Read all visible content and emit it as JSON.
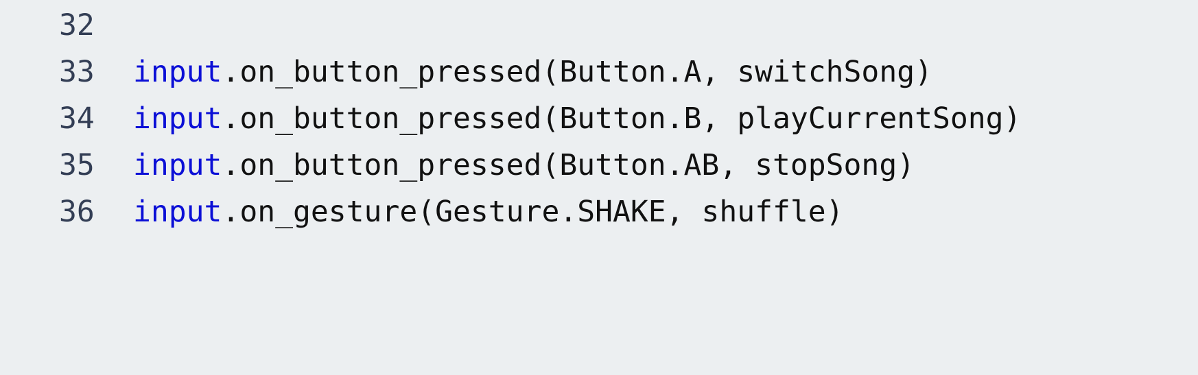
{
  "editor": {
    "lines": [
      {
        "number": "32",
        "keyword": "",
        "rest": ""
      },
      {
        "number": "33",
        "keyword": "input",
        "rest": ".on_button_pressed(Button.A, switchSong)"
      },
      {
        "number": "34",
        "keyword": "input",
        "rest": ".on_button_pressed(Button.B, playCurrentSong)"
      },
      {
        "number": "35",
        "keyword": "input",
        "rest": ".on_button_pressed(Button.AB, stopSong)"
      },
      {
        "number": "36",
        "keyword": "input",
        "rest": ".on_gesture(Gesture.SHAKE, shuffle)"
      }
    ],
    "colors": {
      "background": "#eceff1",
      "line_number": "#333e55",
      "keyword": "#0b0fd6",
      "text": "#111111"
    }
  }
}
